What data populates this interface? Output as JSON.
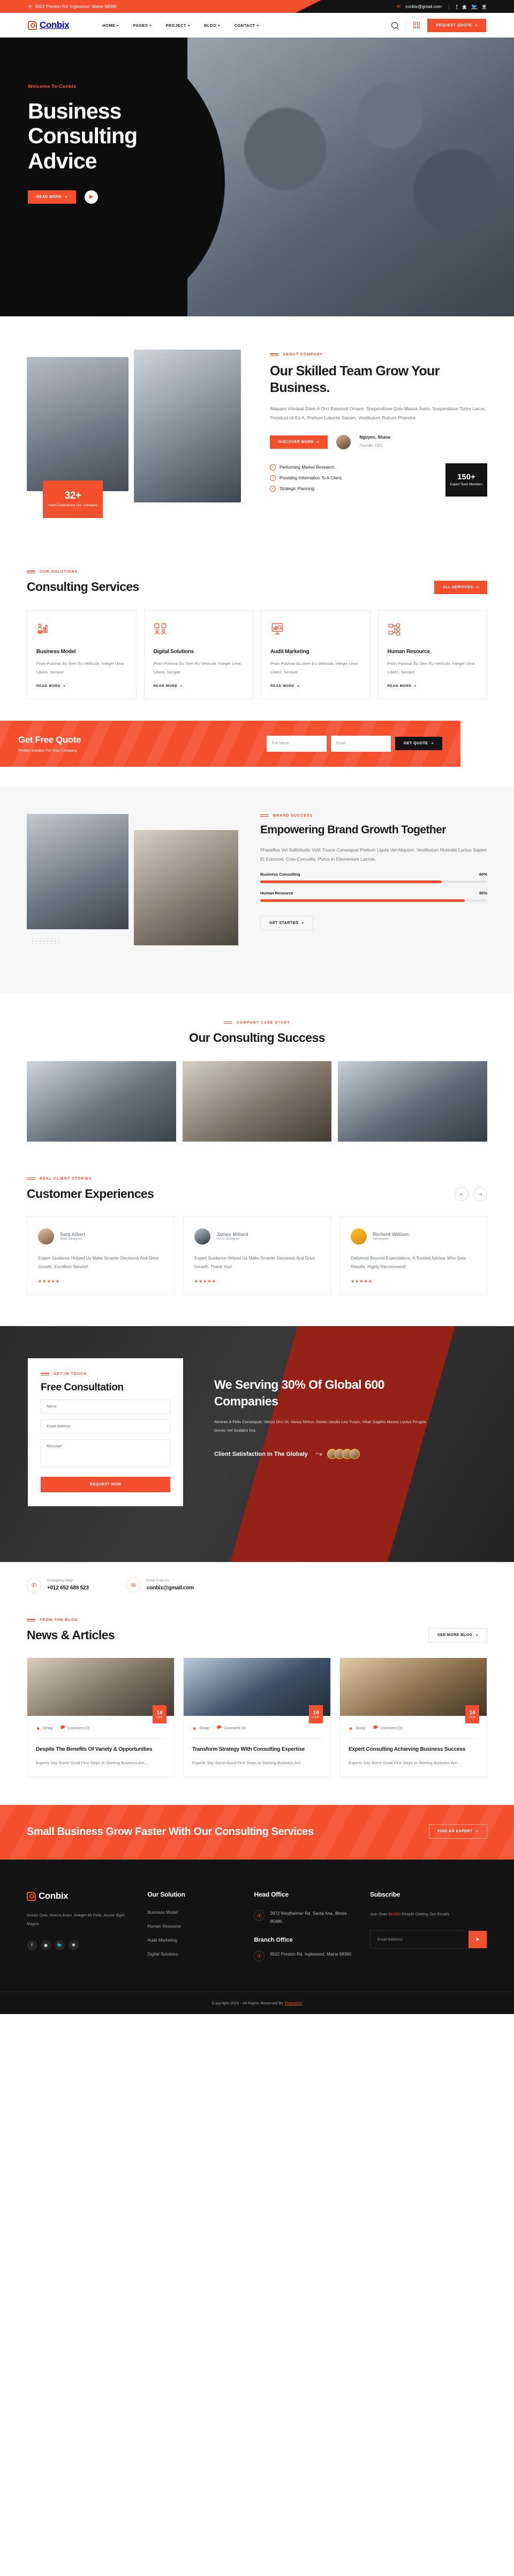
{
  "topbar": {
    "address": "8502 Preston Rd. Inglewood, Maine 98380",
    "email": "conbix@gmail.com",
    "socials": [
      "facebook-icon",
      "instagram-icon",
      "twitter-icon",
      "dribbble-icon"
    ]
  },
  "nav": {
    "brand": "Conbix",
    "menu": [
      "HOME +",
      "PAGES +",
      "PROJECT +",
      "BLOG +",
      "CONTACT +"
    ],
    "cta": "REQUEST QUOTE"
  },
  "hero": {
    "eyebrow": "Welcome To Conbix",
    "title": "Business Consulting Advice",
    "button": "READ MORE"
  },
  "about": {
    "eyebrow": "ABOUT COMPANY",
    "title": "Our Skilled Team Grow Your Business.",
    "text": "Aliquam Volutpat Diam A Orci Euismod Ornare. Suspendisse Quis Massa Justo. Suspendisse Tortor Lacus, Tincidunt Ut Ex A, Pretium Lobortis Sapien. Vestibulum Rutrum Pharetra",
    "button": "DISCOVER MORE",
    "person_name": "Nguyen, Shane",
    "person_role": "Founder CEO",
    "badge_number": "32+",
    "badge_label": "Years Experience Our Company",
    "checks": [
      "Performing Market Research.",
      "Providing Information To A Client.",
      "Strategic Planning."
    ],
    "stat_number": "150+",
    "stat_label": "Expert Team Members"
  },
  "services": {
    "eyebrow": "OUR SOLUTIONS",
    "title": "Consulting Services",
    "button": "ALL SERVICES",
    "read_more": "READ MORE",
    "items": [
      {
        "icon": "analytics-person-icon",
        "title": "Business Model",
        "text": "Proin Pulvinar Eu Sem Eu Vehicula. Integer Urna Libero, Semper"
      },
      {
        "icon": "team-chat-icon",
        "title": "Digital Solutions",
        "text": "Proin Pulvinar Eu Sem Eu Vehicula. Integer Urna Libero, Semper"
      },
      {
        "icon": "chart-board-icon",
        "title": "Audit Marketing",
        "text": "Proin Pulvinar Eu Sem Eu Vehicula. Integer Urna Libero, Semper"
      },
      {
        "icon": "org-network-icon",
        "title": "Human Resource",
        "text": "Proin Pulvinar Eu Sem Eu Vehicula. Integer Urna Libero, Semper"
      }
    ]
  },
  "quote": {
    "title": "Get Free Quote",
    "subtitle": "Perfect Solution For Your Company.",
    "name_placeholder": "Full Name",
    "email_placeholder": "Email",
    "button": "GET QUOTE"
  },
  "brand": {
    "eyebrow": "BRAND SUCCESS",
    "title": "Empowering Brand Growth Together",
    "text": "Phasellus Vel Sollicitudin Velit. Fusce Consequat Pretium Ligula Vel Aliquam. Vestibulum Molestie Luctus Sapien Et Euismod. Cras Convallis, Purus In Elementum Lacinia.",
    "button": "GET STARTED",
    "skills": [
      {
        "label": "Business Consulting",
        "value": 80,
        "display": "80%"
      },
      {
        "label": "Human Resource",
        "value": 90,
        "display": "90%"
      }
    ]
  },
  "cases": {
    "eyebrow": "COMPANY CASE STUDY",
    "title": "Our Consulting Success"
  },
  "testimonials": {
    "eyebrow": "REAL CLIENT STORIES",
    "title": "Customer Experiences",
    "prev": "←",
    "next": "→",
    "items": [
      {
        "name": "Sara Albert",
        "role": "Web Designer",
        "text": "Expert Guidance Helped Us Make Smarter Decisions And Drive Growth. Excellent Service!",
        "stars": "★★★★★"
      },
      {
        "name": "James Millard",
        "role": "Ui/Ux Designer",
        "text": "Expert Guidance Helped Us Make Smarter Decisions And Drive Growth. Thank You!",
        "stars": "★★★★★"
      },
      {
        "name": "Richerd William",
        "role": "Developer",
        "text": "Delivered Beyond Expectations. A Trusted Advisor Who Gets Results. Highly Recommend!",
        "stars": "★★★★★"
      }
    ]
  },
  "consult": {
    "eyebrow": "GET IN TOUCH",
    "title": "Free Consultation",
    "name_placeholder": "Name",
    "email_placeholder": "Email Address",
    "message_placeholder": "Message",
    "button": "REQUEST NOW",
    "right_title": "We Serving 30% Of Global 600 Companies",
    "right_text": "Aenean A Felis Consequat, Varius Orci Ut, Varius Metus. Donec Iaculis Leo Turpis, Vitae Sagittis Massa Luctus Feugiat. Donec Vel Sodales Dui,",
    "satisfaction": "Client Satisfaction In The Globaly"
  },
  "contact_strip": {
    "phone_label": "Emargency Help",
    "phone_value": "+012 652 689 523",
    "email_label": "Email Drop Us",
    "email_value": "conbix@gmail.com"
  },
  "blog": {
    "eyebrow": "FROM THE BLOG",
    "title": "News & Articles",
    "button": "SEE MORE BLOG",
    "posts": [
      {
        "day": "14",
        "month": "FEB",
        "author": "Oriwp",
        "comments": "Comment (0)",
        "title": "Despite The Benefits Of Variety & Opportunities",
        "excerpt": "Experts Say Some Good First Steps In Starting Business Are..."
      },
      {
        "day": "14",
        "month": "FEB",
        "author": "Oriwp",
        "comments": "Comment (0)",
        "title": "Transform Strategy With Consulting Expertise",
        "excerpt": "Experts Say Some Good First Steps In Starting Business Are..."
      },
      {
        "day": "14",
        "month": "FEB",
        "author": "Oriwp",
        "comments": "Comment (0)",
        "title": "Expert Consulting Achieving Business Success",
        "excerpt": "Experts Say Some Good First Steps In Starting Business Are..."
      }
    ]
  },
  "cta": {
    "title": "Small Business Grow Faster With Our Consulting Services",
    "button": "FIND AN EXPERT"
  },
  "footer": {
    "brand": "Conbix",
    "about": "Donec Quis Viverra Enim. Integer Mi Felis, Auctor Eget Magna",
    "socials": [
      "facebook-icon",
      "instagram-icon",
      "twitter-icon",
      "dribbble-icon"
    ],
    "solution_title": "Our Solution",
    "solution_links": [
      "Business Model",
      "Human Resource",
      "Audit Marketing",
      "Digital Solutions"
    ],
    "head_office_title": "Head Office",
    "head_office_address": "2972 Westheimer Rd. Santa Ana, Illinois 85486",
    "branch_office_title": "Branch Office",
    "branch_office_address": "8502 Preston Rd. Inglewood, Maine 98380",
    "subscribe_title": "Subscribe",
    "subscribe_text_pre": "Join Over ",
    "subscribe_count": "68,000",
    "subscribe_text_post": " People Getting Our Emails",
    "email_placeholder": "Email Address",
    "copyright_pre": "Copyright 2023 - All Rights Reserved By ",
    "copyright_link": "ThemeOri"
  }
}
